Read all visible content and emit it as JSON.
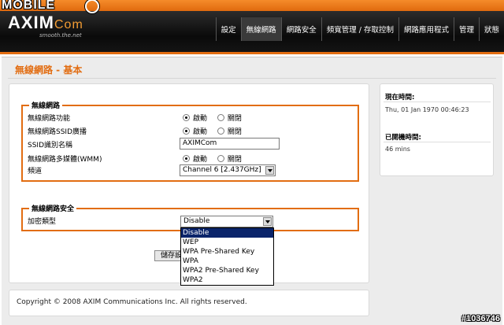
{
  "watermark": {
    "brand": "MOBILE",
    "id": "#1036746"
  },
  "logo": {
    "main": "AXIM",
    "accent": "Com",
    "tagline": "smooth.the.net"
  },
  "nav": [
    {
      "label": "設定"
    },
    {
      "label": "無線網路"
    },
    {
      "label": "網路安全"
    },
    {
      "label": "頻寬管理 / 存取控制"
    },
    {
      "label": "網路應用程式"
    },
    {
      "label": "管理"
    },
    {
      "label": "狀態"
    }
  ],
  "page": {
    "title": "無線網路 - 基本"
  },
  "wireless": {
    "legend": "無線網路",
    "function_label": "無線網路功能",
    "ssid_broadcast_label": "無線網路SSID廣播",
    "ssid_label": "SSID識別名稱",
    "ssid_value": "AXIMCom",
    "wmm_label": "無線網路多媒體(WMM)",
    "channel_label": "頻道",
    "channel_value": "Channel 6 [2.437GHz]",
    "enable": "啟動",
    "disable": "關閉"
  },
  "security": {
    "legend": "無線網路安全",
    "encryption_label": "加密類型",
    "encryption_value": "Disable",
    "options": [
      "Disable",
      "WEP",
      "WPA Pre-Shared Key",
      "WPA",
      "WPA2 Pre-Shared Key",
      "WPA2"
    ]
  },
  "save_label": "儲存設定",
  "sidebar": {
    "time_label": "現在時間:",
    "time_value": "Thu, 01 Jan 1970 00:46:23",
    "uptime_label": "已開機時間:",
    "uptime_value": "46 mins"
  },
  "footer": {
    "copyright": "Copyright © 2008 AXIM Communications Inc. All rights reserved."
  },
  "colors": {
    "accent": "#e26d12",
    "header": "#111111",
    "selection": "#0a246a"
  }
}
